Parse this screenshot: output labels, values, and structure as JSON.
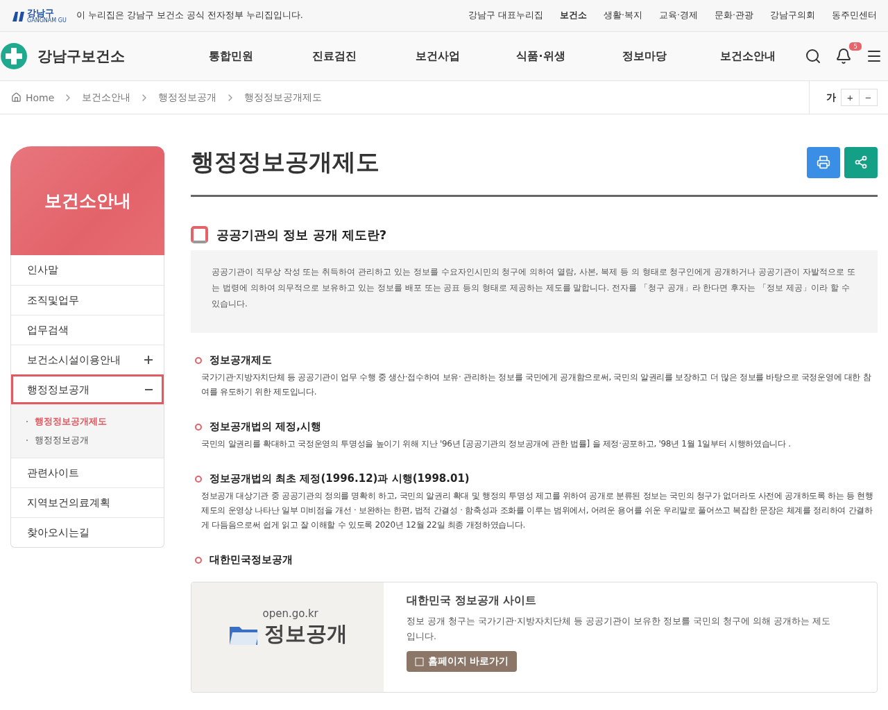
{
  "top_bar": {
    "logo_text": "강남구",
    "logo_sub": "GANGNAM GU",
    "notice": "이 누리집은 강남구 보건소 공식 전자정부 누리집입니다.",
    "links": [
      {
        "label": "강남구 대표누리집",
        "selected": false
      },
      {
        "label": "보건소",
        "selected": true
      },
      {
        "label": "생활·복지",
        "selected": false
      },
      {
        "label": "교육·경제",
        "selected": false
      },
      {
        "label": "문화·관광",
        "selected": false
      },
      {
        "label": "강남구의회",
        "selected": false
      },
      {
        "label": "동주민센터",
        "selected": false
      }
    ]
  },
  "header": {
    "site_name": "강남구보건소",
    "nav": [
      "통합민원",
      "진료검진",
      "보건사업",
      "식품·위생",
      "정보마당",
      "보건소안내"
    ],
    "notification_count": "5"
  },
  "breadcrumb": {
    "items": [
      "Home",
      "보건소안내",
      "행정정보공개",
      "행정정보공개제도"
    ],
    "font_size": {
      "label": "가",
      "increase": "+",
      "decrease": "−"
    }
  },
  "sidebar": {
    "title": "보건소안내",
    "items": [
      {
        "label": "인사말",
        "kind": "link",
        "selected": false
      },
      {
        "label": "조직및업무",
        "kind": "link",
        "selected": false
      },
      {
        "label": "업무검색",
        "kind": "link",
        "selected": false
      },
      {
        "label": "보건소시설이용안내",
        "kind": "group",
        "selected": false,
        "expanded": false
      },
      {
        "label": "행정정보공개",
        "kind": "group",
        "selected": true,
        "expanded": true,
        "children": [
          {
            "label": "행정정보공개제도",
            "selected": true
          },
          {
            "label": "행정정보공개",
            "selected": false
          }
        ]
      },
      {
        "label": "관련사이트",
        "kind": "link",
        "selected": false
      },
      {
        "label": "지역보건의료계획",
        "kind": "link",
        "selected": false
      },
      {
        "label": "찾아오시는길",
        "kind": "link",
        "selected": false
      }
    ]
  },
  "content": {
    "title": "행정정보공개제도",
    "heading": "공공기관의 정보 공개 제도란?",
    "intro": "공공기관이 직무상 작성 또는 취득하여 관리하고 있는 정보를 수요자인시민의 청구에 의하여 열람, 사본, 복제 등 의 형태로 청구인에게 공개하거나 공공기관이 자발적으로 또는 법령에 의하여 의무적으로 보유하고 있는 정보를 배포 또는 공표 등의 형태로 제공하는 제도를 말합니다. 전자를 「청구 공개」라 한다면 후자는 「정보 제공」이라 할 수 있습니다.",
    "sections": [
      {
        "heading": "정보공개제도",
        "text": "국가기관·지방자치단체 등 공공기관이 업무 수행 중 생산·접수하여 보유· 관리하는 정보를 국민에게 공개함으로써, 국민의 알권리를 보장하고 더 많은 정보를 바탕으로 국정운영에 대한 참여를 유도하기 위한 제도입니다."
      },
      {
        "heading": "정보공개법의 제정,시행",
        "text": "국민의 알권리를 확대하고 국정운영의 투명성을 높이기 위해 지난 '96년 [공공기관의 정보공개에 관한 법률] 을 제정·공포하고, '98년 1월 1일부터 시행하였습니다 ."
      },
      {
        "heading": "정보공개법의 최초 제정(1996.12)과 시행(1998.01)",
        "text": "정보공개 대상기관 중 공공기관의 정의를 명확히 하고, 국민의 알권리 확대 및 행정의 투명성 제고를 위하여 공개로 분류된 정보는 국민의 청구가 없더라도 사전에 공개하도록 하는 등 현행 제도의 운영상 나타난 일부 미비점을 개선 · 보완하는 한편, 법적 간결성 · 함축성과 조화를 이루는 범위에서, 어려운 용어를 쉬운 우리말로 풀어쓰고 복잡한 문장은 체계를 정리하여 간결하게 다듬음으로써 쉽게 읽고 잘 이해할 수 있도록 2020년 12월 22일 최종 개정하였습니다."
      },
      {
        "heading": "대한민국정보공개"
      }
    ],
    "site_card": {
      "logo_domain": "open.go.kr",
      "logo_text": "정보공개",
      "title": "대한민국 정보공개 사이트",
      "text": "정보 공개 청구는 국가기관·지방자치단체 등 공공기관이 보유한 정보를 국민의 청구에 의해 공개하는 제도입니다.",
      "button": "홈페이지 바로가기"
    }
  }
}
